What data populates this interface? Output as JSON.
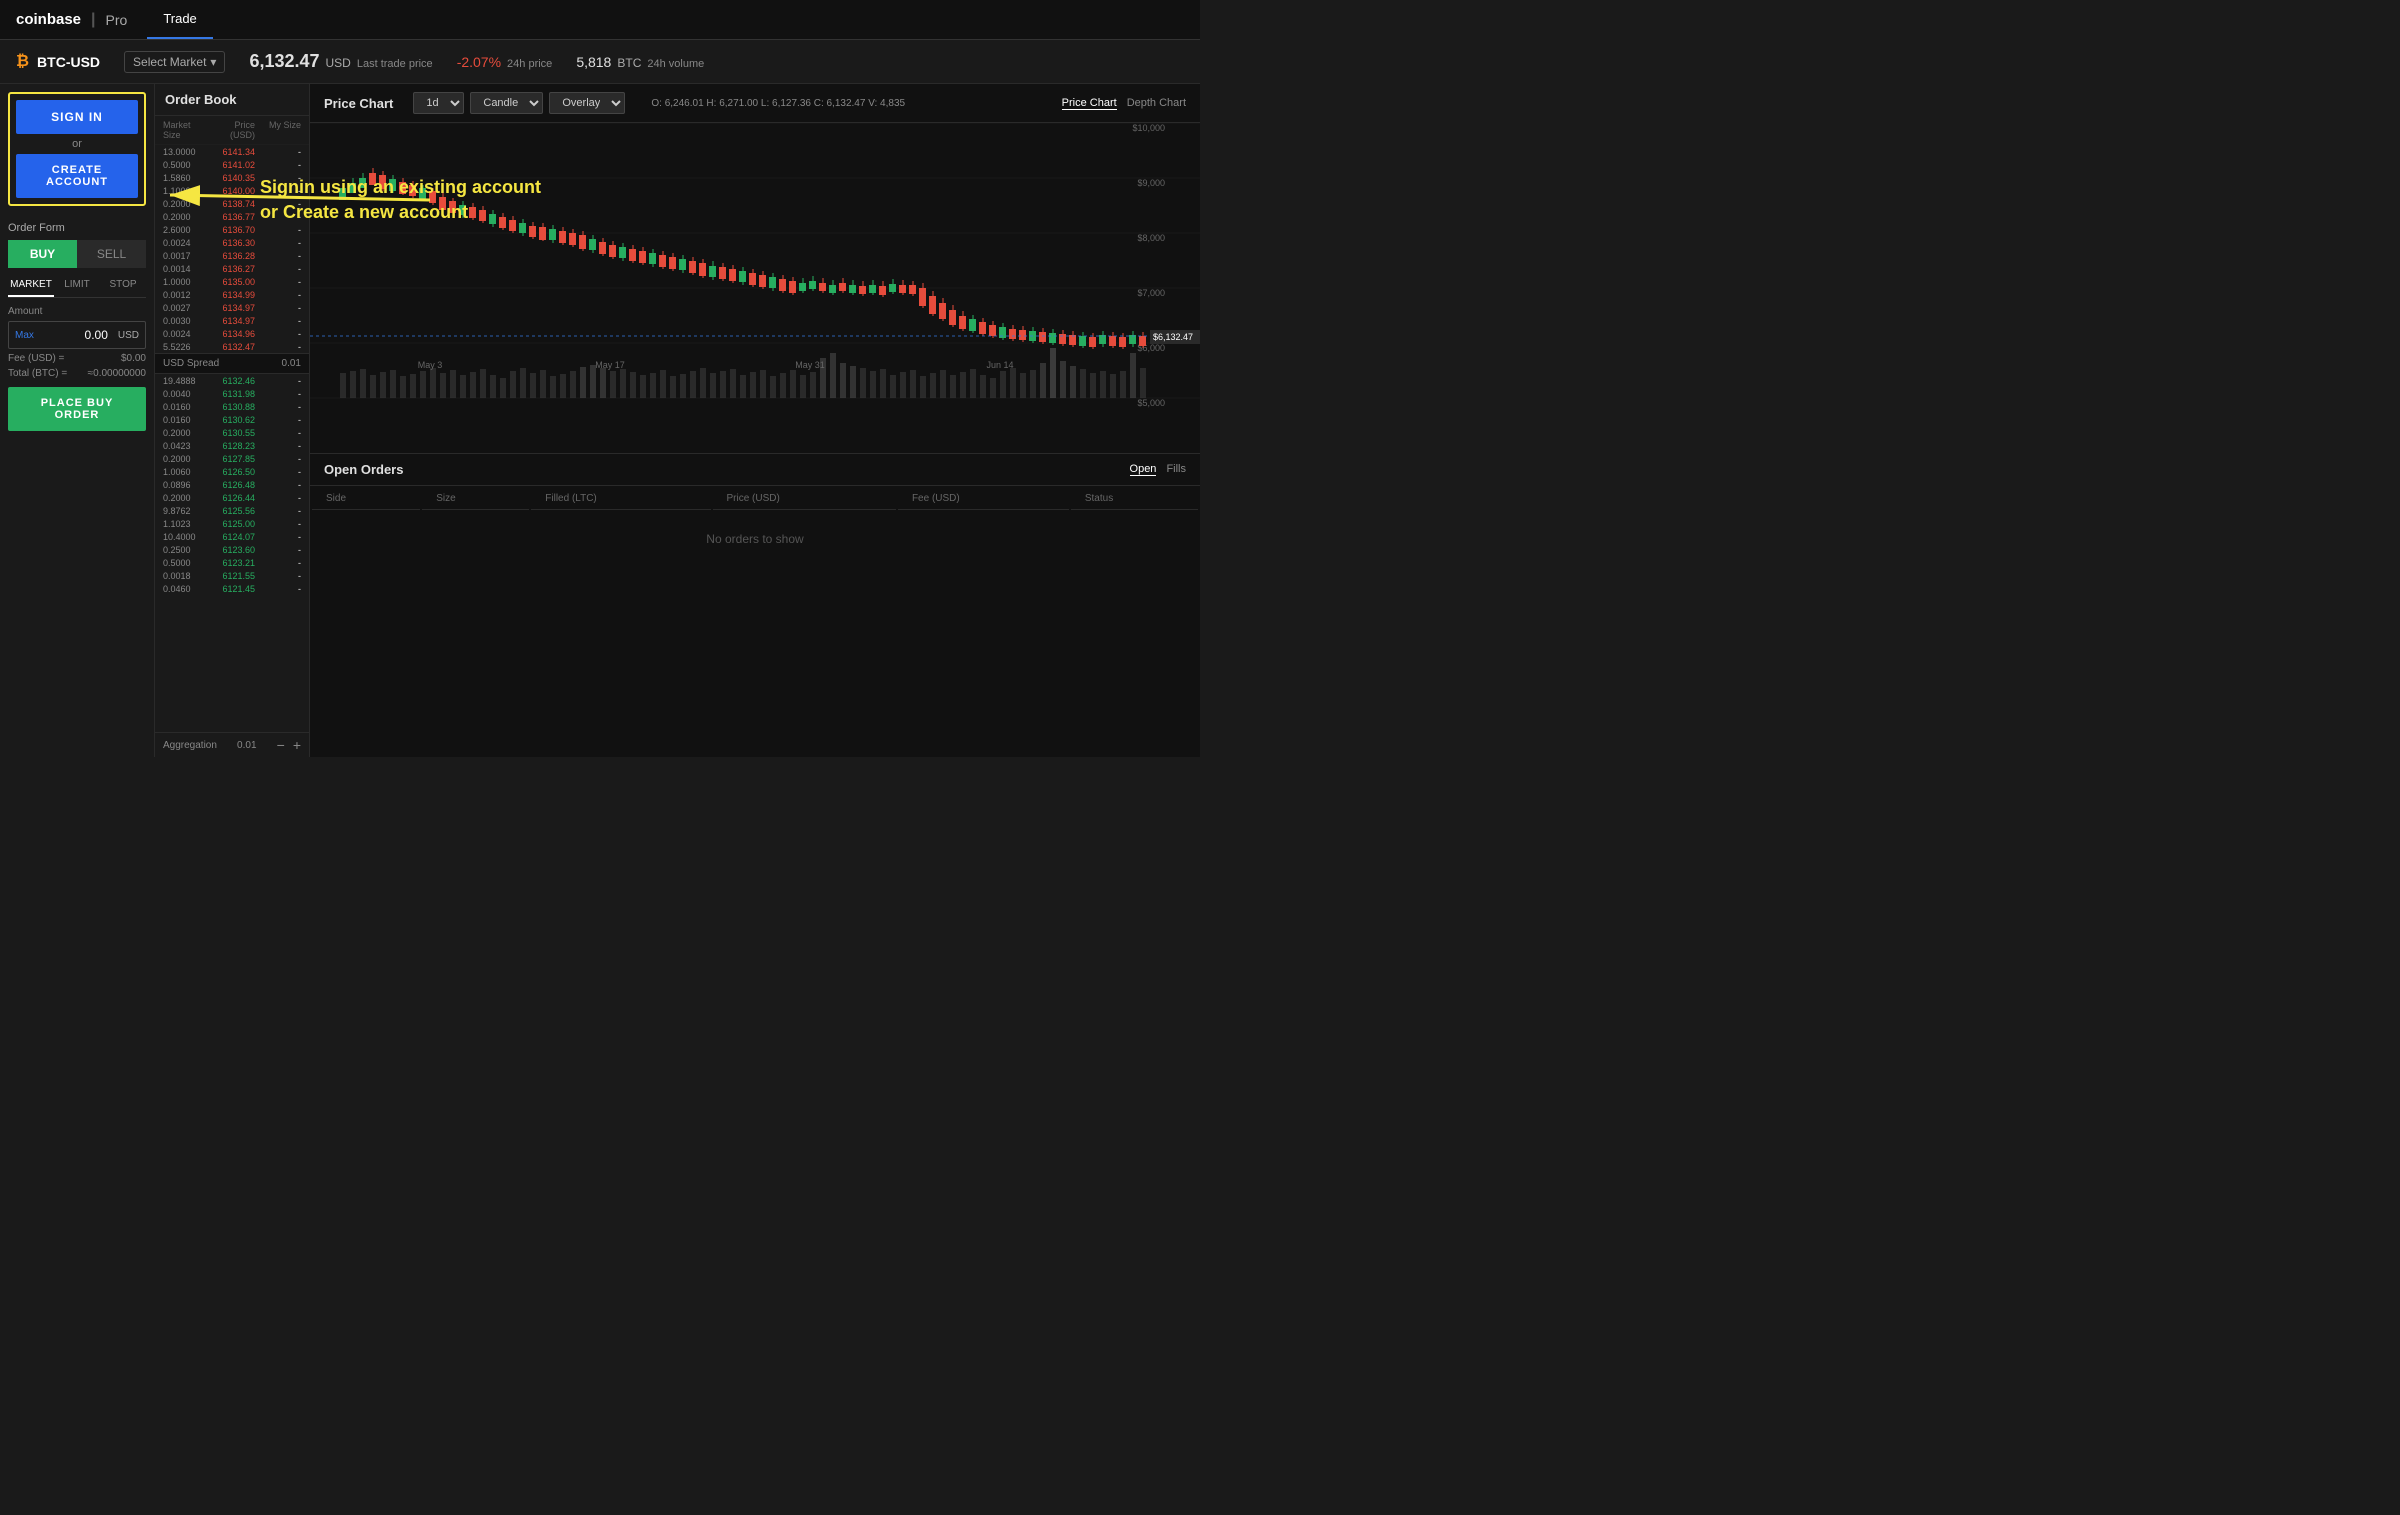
{
  "header": {
    "logo": "coinbase",
    "divider": "|",
    "pro": "Pro",
    "nav_tabs": [
      {
        "label": "Trade",
        "active": true
      }
    ]
  },
  "ticker": {
    "icon": "₿",
    "symbol": "BTC-USD",
    "select_market": "Select Market",
    "price": "6,132.47",
    "price_currency": "USD",
    "price_label": "Last trade price",
    "change": "-2.07%",
    "change_label": "24h price",
    "volume": "5,818",
    "volume_currency": "BTC",
    "volume_label": "24h volume"
  },
  "signin_box": {
    "signin_label": "SIGN IN",
    "or_label": "or",
    "create_label": "CREATE ACCOUNT"
  },
  "order_form": {
    "title": "Order Form",
    "buy_label": "BUY",
    "sell_label": "SELL",
    "type_tabs": [
      "MARKET",
      "LIMIT",
      "STOP"
    ],
    "active_type": "MARKET",
    "amount_label": "Amount",
    "max_link": "Max",
    "amount_value": "0.00",
    "amount_currency": "USD",
    "fee_label": "Fee (USD) =",
    "fee_value": "$0.00",
    "total_label": "Total (BTC) =",
    "total_value": "≈0.00000000",
    "place_order_label": "PLACE BUY ORDER"
  },
  "order_book": {
    "title": "Order Book",
    "col_market_size": "Market Size",
    "col_price": "Price (USD)",
    "col_my_size": "My Size",
    "ask_rows": [
      {
        "size": "13.0000",
        "price": "6141.34",
        "my_size": "-"
      },
      {
        "size": "0.5000",
        "price": "6141.02",
        "my_size": "-"
      },
      {
        "size": "1.5860",
        "price": "6140.35",
        "my_size": "-"
      },
      {
        "size": "1.1000",
        "price": "6140.00",
        "my_size": "-"
      },
      {
        "size": "0.2000",
        "price": "6138.74",
        "my_size": "-"
      },
      {
        "size": "0.2000",
        "price": "6136.77",
        "my_size": "-"
      },
      {
        "size": "2.6000",
        "price": "6136.70",
        "my_size": "-"
      },
      {
        "size": "0.0024",
        "price": "6136.30",
        "my_size": "-"
      },
      {
        "size": "0.0017",
        "price": "6136.28",
        "my_size": "-"
      },
      {
        "size": "0.0014",
        "price": "6136.27",
        "my_size": "-"
      },
      {
        "size": "1.0000",
        "price": "6135.00",
        "my_size": "-"
      },
      {
        "size": "0.0012",
        "price": "6134.99",
        "my_size": "-"
      },
      {
        "size": "0.0027",
        "price": "6134.97",
        "my_size": "-"
      },
      {
        "size": "0.0030",
        "price": "6134.97",
        "my_size": "-"
      },
      {
        "size": "0.0024",
        "price": "6134.96",
        "my_size": "-"
      },
      {
        "size": "5.5226",
        "price": "6132.47",
        "my_size": "-"
      }
    ],
    "spread_label": "USD Spread",
    "spread_value": "0.01",
    "bid_rows": [
      {
        "size": "19.4888",
        "price": "6132.46",
        "my_size": "-"
      },
      {
        "size": "0.0040",
        "price": "6131.98",
        "my_size": "-"
      },
      {
        "size": "0.0160",
        "price": "6130.88",
        "my_size": "-"
      },
      {
        "size": "0.0160",
        "price": "6130.62",
        "my_size": "-"
      },
      {
        "size": "0.2000",
        "price": "6130.55",
        "my_size": "-"
      },
      {
        "size": "0.0423",
        "price": "6128.23",
        "my_size": "-"
      },
      {
        "size": "0.2000",
        "price": "6127.85",
        "my_size": "-"
      },
      {
        "size": "1.0060",
        "price": "6126.50",
        "my_size": "-"
      },
      {
        "size": "0.0896",
        "price": "6126.48",
        "my_size": "-"
      },
      {
        "size": "0.2000",
        "price": "6126.44",
        "my_size": "-"
      },
      {
        "size": "9.8762",
        "price": "6125.56",
        "my_size": "-"
      },
      {
        "size": "1.1023",
        "price": "6125.00",
        "my_size": "-"
      },
      {
        "size": "10.4000",
        "price": "6124.07",
        "my_size": "-"
      },
      {
        "size": "0.2500",
        "price": "6123.60",
        "my_size": "-"
      },
      {
        "size": "0.5000",
        "price": "6123.21",
        "my_size": "-"
      },
      {
        "size": "0.0018",
        "price": "6121.55",
        "my_size": "-"
      },
      {
        "size": "0.0460",
        "price": "6121.45",
        "my_size": "-"
      }
    ],
    "aggregation_label": "Aggregation",
    "aggregation_value": "0.01"
  },
  "price_chart": {
    "title": "Price Chart",
    "tab_price": "Price Chart",
    "tab_depth": "Depth Chart",
    "timeframe": "1d",
    "chart_type": "Candle",
    "overlay_label": "Overlay",
    "ohlcv": "O: 6,246.01  H: 6,271.00  L: 6,127.36  C: 6,132.47  V: 4,835",
    "price_labels": [
      "$10,000",
      "$9,000",
      "$8,000",
      "$7,000",
      "$6,000",
      "$5,000"
    ],
    "date_labels": [
      "May 3",
      "May 17",
      "May 31",
      "Jun 14"
    ],
    "current_price": "$6,132.47"
  },
  "open_orders": {
    "title": "Open Orders",
    "tab_open": "Open",
    "tab_fills": "Fills",
    "col_side": "Side",
    "col_size": "Size",
    "col_filled": "Filled (LTC)",
    "col_price": "Price (USD)",
    "col_fee": "Fee (USD)",
    "col_status": "Status",
    "no_orders_msg": "No orders to show"
  },
  "annotation": {
    "text": "Signin using an existing account\nor Create a new account"
  }
}
